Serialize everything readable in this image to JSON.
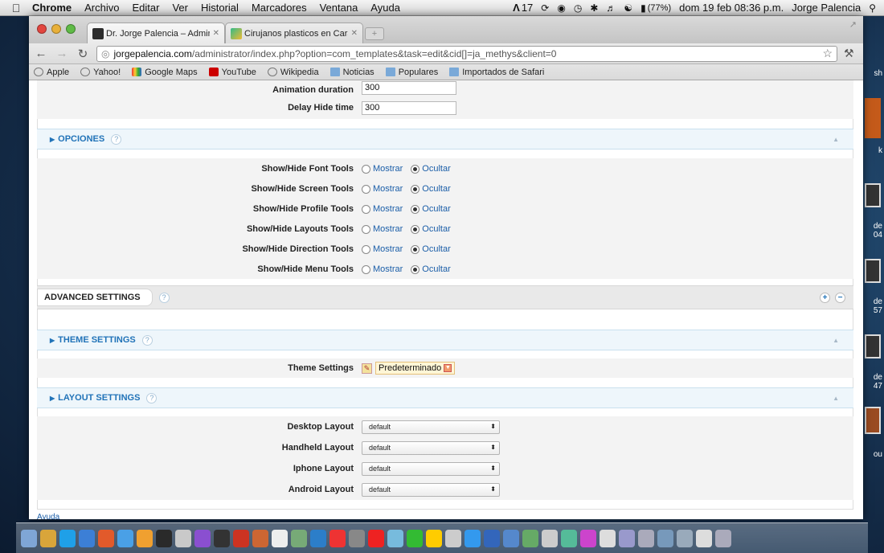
{
  "menubar": {
    "app_name": "Chrome",
    "menus": [
      "Archivo",
      "Editar",
      "Ver",
      "Historial",
      "Marcadores",
      "Ventana",
      "Ayuda"
    ],
    "adobe_count": "17",
    "battery": "(77%)",
    "datetime": "dom 19 feb  08:36 p.m.",
    "user": "Jorge Palencia"
  },
  "browser": {
    "tabs": [
      {
        "title": "Dr. Jorge Palencia – Administ",
        "active": true
      },
      {
        "title": "Cirujanos plasticos en Carac",
        "active": false
      }
    ],
    "url_domain": "jorgepalencia.com",
    "url_path": "/administrator/index.php?option=com_templates&task=edit&cid[]=ja_methys&client=0",
    "bookmarks": [
      "Apple",
      "Yahoo!",
      "Google Maps",
      "YouTube",
      "Wikipedia",
      "Noticias",
      "Populares",
      "Importados de Safari"
    ]
  },
  "top_fields": [
    {
      "label": "Animation duration",
      "value": "300"
    },
    {
      "label": "Delay Hide time",
      "value": "300"
    }
  ],
  "opciones": {
    "title": "OPCIONES",
    "help": "?",
    "option_on": "Mostrar",
    "option_off": "Ocultar",
    "rows": [
      {
        "label": "Show/Hide Font Tools",
        "selected": "Ocultar"
      },
      {
        "label": "Show/Hide Screen Tools",
        "selected": "Ocultar"
      },
      {
        "label": "Show/Hide Profile Tools",
        "selected": "Ocultar"
      },
      {
        "label": "Show/Hide Layouts Tools",
        "selected": "Ocultar"
      },
      {
        "label": "Show/Hide Direction Tools",
        "selected": "Ocultar"
      },
      {
        "label": "Show/Hide Menu Tools",
        "selected": "Ocultar"
      }
    ]
  },
  "advanced": {
    "title": "ADVANCED SETTINGS",
    "help": "?"
  },
  "theme": {
    "title": "THEME SETTINGS",
    "help": "?",
    "row_label": "Theme Settings",
    "value": "Predeterminado"
  },
  "layout": {
    "title": "LAYOUT SETTINGS",
    "help": "?",
    "rows": [
      {
        "label": "Desktop Layout",
        "value": "default"
      },
      {
        "label": "Handheld Layout",
        "value": "default"
      },
      {
        "label": "Iphone Layout",
        "value": "default"
      },
      {
        "label": "Android Layout",
        "value": "default"
      }
    ]
  },
  "footer": {
    "link": "Ayuda"
  },
  "desktop_labels": [
    "sh",
    "k",
    "de\n04",
    "de\n57",
    "de\n47",
    "ou"
  ]
}
